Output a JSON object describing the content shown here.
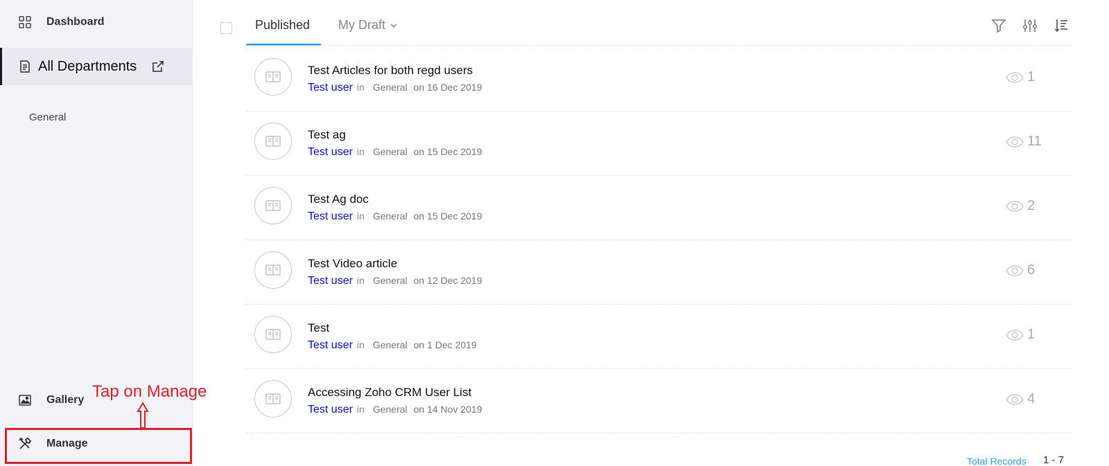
{
  "sidebar": {
    "dashboard": {
      "label": "Dashboard",
      "icon": "grid-icon"
    },
    "all_departments": {
      "label": "All Departments",
      "icon": "document-icon",
      "ext_icon": "external-link-icon"
    },
    "general": {
      "label": "General"
    },
    "gallery": {
      "label": "Gallery",
      "icon": "image-icon"
    },
    "manage": {
      "label": "Manage",
      "icon": "tools-icon"
    }
  },
  "annotation": {
    "text": "Tap on Manage",
    "color": "#e0202a"
  },
  "tabs": {
    "published": {
      "label": "Published"
    },
    "my_draft": {
      "label": "My Draft"
    }
  },
  "toolbar": {
    "filter_icon": "filter-icon",
    "adjust_icon": "sliders-icon",
    "sort_icon": "sort-icon"
  },
  "articles": [
    {
      "title": "Test Articles for both regd users",
      "author": "Test user",
      "in": "in",
      "category": "General",
      "date": "on 16 Dec 2019",
      "views": "1"
    },
    {
      "title": "Test ag",
      "author": "Test user",
      "in": "in",
      "category": "General",
      "date": "on 15 Dec 2019",
      "views": "11"
    },
    {
      "title": "Test Ag doc",
      "author": "Test user",
      "in": "in",
      "category": "General",
      "date": "on 15 Dec 2019",
      "views": "2"
    },
    {
      "title": "Test Video article",
      "author": "Test user",
      "in": "in",
      "category": "General",
      "date": "on 12 Dec 2019",
      "views": "6"
    },
    {
      "title": "Test",
      "author": "Test user",
      "in": "in",
      "category": "General",
      "date": "on 1 Dec 2019",
      "views": "1"
    },
    {
      "title": "Accessing Zoho CRM User List",
      "author": "Test user",
      "in": "in",
      "category": "General",
      "date": "on 14 Nov 2019",
      "views": "4"
    }
  ],
  "footer": {
    "total_label": "Total Records",
    "range": "1 - 7"
  },
  "colors": {
    "accent": "#2aa3e6",
    "author_link": "#0b0bd6",
    "annotation": "#e0202a"
  }
}
